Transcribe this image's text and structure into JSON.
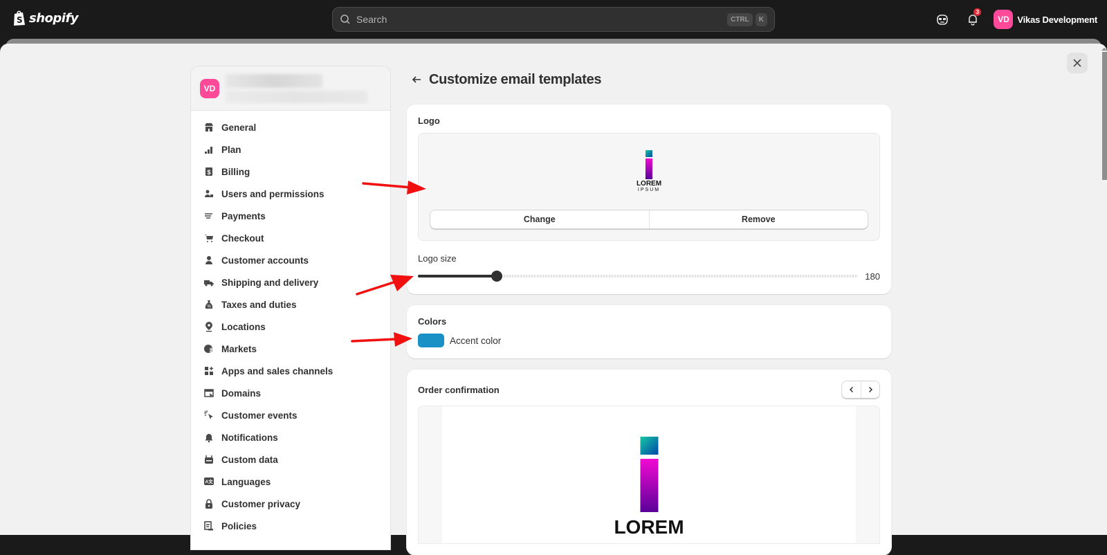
{
  "topbar": {
    "brand": "shopify",
    "search_placeholder": "Search",
    "shortcut_keys": [
      "CTRL",
      "K"
    ],
    "notification_count": "3",
    "store_initials": "VD",
    "store_name": "Vikas Development"
  },
  "sidebar": {
    "store_initials": "VD",
    "items": [
      {
        "label": "General",
        "icon": "store-icon"
      },
      {
        "label": "Plan",
        "icon": "plan-icon"
      },
      {
        "label": "Billing",
        "icon": "billing-icon"
      },
      {
        "label": "Users and permissions",
        "icon": "users-icon"
      },
      {
        "label": "Payments",
        "icon": "payments-icon"
      },
      {
        "label": "Checkout",
        "icon": "cart-icon"
      },
      {
        "label": "Customer accounts",
        "icon": "person-icon"
      },
      {
        "label": "Shipping and delivery",
        "icon": "truck-icon"
      },
      {
        "label": "Taxes and duties",
        "icon": "tax-icon"
      },
      {
        "label": "Locations",
        "icon": "location-icon"
      },
      {
        "label": "Markets",
        "icon": "globe-icon"
      },
      {
        "label": "Apps and sales channels",
        "icon": "apps-icon"
      },
      {
        "label": "Domains",
        "icon": "domains-icon"
      },
      {
        "label": "Customer events",
        "icon": "cursor-icon"
      },
      {
        "label": "Notifications",
        "icon": "bell-icon"
      },
      {
        "label": "Custom data",
        "icon": "data-icon"
      },
      {
        "label": "Languages",
        "icon": "language-icon"
      },
      {
        "label": "Customer privacy",
        "icon": "lock-icon"
      },
      {
        "label": "Policies",
        "icon": "policies-icon"
      }
    ]
  },
  "main": {
    "title": "Customize email templates",
    "logo_card": {
      "title": "Logo",
      "logo_text_top": "LOREM",
      "logo_text_bottom": "IPSUM",
      "change_label": "Change",
      "remove_label": "Remove",
      "size_label": "Logo size",
      "size_value": "180",
      "size_fraction": 0.18
    },
    "colors_card": {
      "title": "Colors",
      "accent_label": "Accent color",
      "accent_color": "#1990c6"
    },
    "preview_card": {
      "title": "Order confirmation",
      "logo_text_top": "LOREM"
    }
  }
}
